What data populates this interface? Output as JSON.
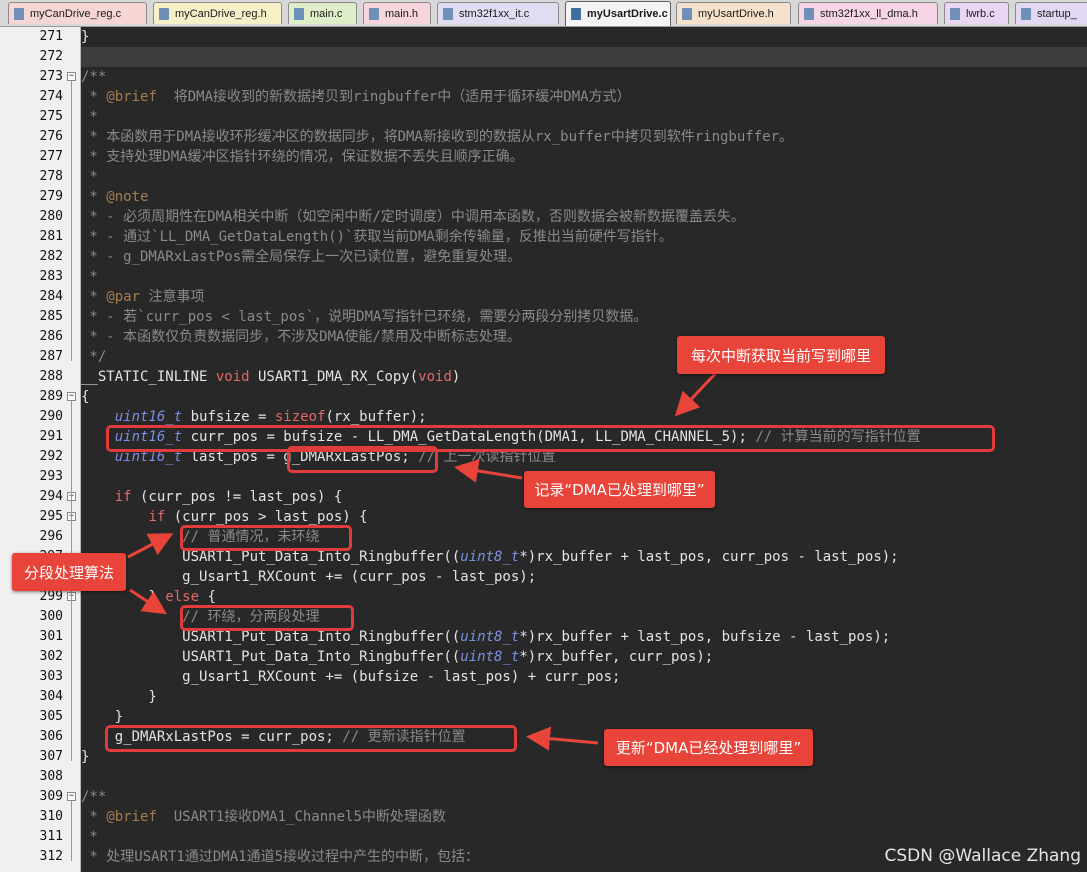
{
  "tabs": [
    {
      "label": "myCanDrive_reg.c",
      "icon": "c-file-icon",
      "color": "#f6d5d5",
      "active": false
    },
    {
      "label": "myCanDrive_reg.h",
      "icon": "h-file-icon",
      "color": "#f6f0c8",
      "active": false
    },
    {
      "label": "main.c",
      "icon": "c-file-icon",
      "color": "#dfeec8",
      "active": false
    },
    {
      "label": "main.h",
      "icon": "h-file-icon",
      "color": "#f6d5dc",
      "active": false
    },
    {
      "label": "stm32f1xx_it.c",
      "icon": "c-file-icon",
      "color": "#e2dcf2",
      "active": false
    },
    {
      "label": "myUsartDrive.c",
      "icon": "c-file-icon",
      "color": "#d8ecec",
      "active": true
    },
    {
      "label": "myUsartDrive.h",
      "icon": "h-file-icon",
      "color": "#f6e2cc",
      "active": false
    },
    {
      "label": "stm32f1xx_ll_dma.h",
      "icon": "h-file-icon",
      "color": "#f6d5e6",
      "active": false
    },
    {
      "label": "lwrb.c",
      "icon": "c-file-icon",
      "color": "#ead5f2",
      "active": false
    },
    {
      "label": "startup_",
      "icon": "asm-file-icon",
      "color": "#e2d8f2",
      "active": false
    }
  ],
  "line_numbers": [
    "271",
    "272",
    "273",
    "274",
    "275",
    "276",
    "277",
    "278",
    "279",
    "280",
    "281",
    "282",
    "283",
    "284",
    "285",
    "286",
    "287",
    "288",
    "289",
    "290",
    "291",
    "292",
    "293",
    "294",
    "295",
    "296",
    "297",
    "298",
    "299",
    "300",
    "301",
    "302",
    "303",
    "304",
    "305",
    "306",
    "307",
    "308",
    "309",
    "310",
    "311",
    "312"
  ],
  "code_lines": [
    "}",
    "",
    "/**",
    " * @brief  将DMA接收到的新数据拷贝到ringbuffer中（适用于循环缓冲DMA方式）",
    " *",
    " * 本函数用于DMA接收环形缓冲区的数据同步，将DMA新接收到的数据从rx_buffer中拷贝到软件ringbuffer。",
    " * 支持处理DMA缓冲区指针环绕的情况，保证数据不丢失且顺序正确。",
    " *",
    " * @note",
    " * - 必须周期性在DMA相关中断（如空闲中断/定时调度）中调用本函数，否则数据会被新数据覆盖丢失。",
    " * - 通过`LL_DMA_GetDataLength()`获取当前DMA剩余传输量，反推出当前硬件写指针。",
    " * - g_DMARxLastPos需全局保存上一次已读位置，避免重复处理。",
    " *",
    " * @par 注意事项",
    " * - 若`curr_pos < last_pos`，说明DMA写指针已环绕，需要分两段分别拷贝数据。",
    " * - 本函数仅负责数据同步，不涉及DMA使能/禁用及中断标志处理。",
    " */",
    "__STATIC_INLINE void USART1_DMA_RX_Copy(void)",
    "{",
    "    uint16_t bufsize = sizeof(rx_buffer);",
    "    uint16_t curr_pos = bufsize - LL_DMA_GetDataLength(DMA1, LL_DMA_CHANNEL_5); // 计算当前的写指针位置",
    "    uint16_t last_pos = g_DMARxLastPos; // 上一次读指针位置",
    "",
    "    if (curr_pos != last_pos) {",
    "        if (curr_pos > last_pos) {",
    "            // 普通情况，未环绕",
    "            USART1_Put_Data_Into_Ringbuffer((uint8_t*)rx_buffer + last_pos, curr_pos - last_pos);",
    "            g_Usart1_RXCount += (curr_pos - last_pos);",
    "        } else {",
    "            // 环绕，分两段处理",
    "            USART1_Put_Data_Into_Ringbuffer((uint8_t*)rx_buffer + last_pos, bufsize - last_pos);",
    "            USART1_Put_Data_Into_Ringbuffer((uint8_t*)rx_buffer, curr_pos);",
    "            g_Usart1_RXCount += (bufsize - last_pos) + curr_pos;",
    "        }",
    "    }",
    "    g_DMARxLastPos = curr_pos; // 更新读指针位置",
    "}",
    "",
    "/**",
    " * @brief  USART1接收DMA1_Channel5中断处理函数",
    " *",
    " * 处理USART1通过DMA1通道5接收过程中产生的中断，包括："
  ],
  "annotations": {
    "callout_1": "每次中断获取当前写到哪里",
    "callout_2": "记录“DMA已处理到哪里”",
    "callout_3": "分段处理算法",
    "callout_4": "更新“DMA已经处理到哪里”"
  },
  "watermark": "CSDN @Wallace Zhang",
  "colors": {
    "annotation": "#e8443a",
    "editor_bg": "#282828",
    "gutter_bg": "#f0f0f0"
  }
}
